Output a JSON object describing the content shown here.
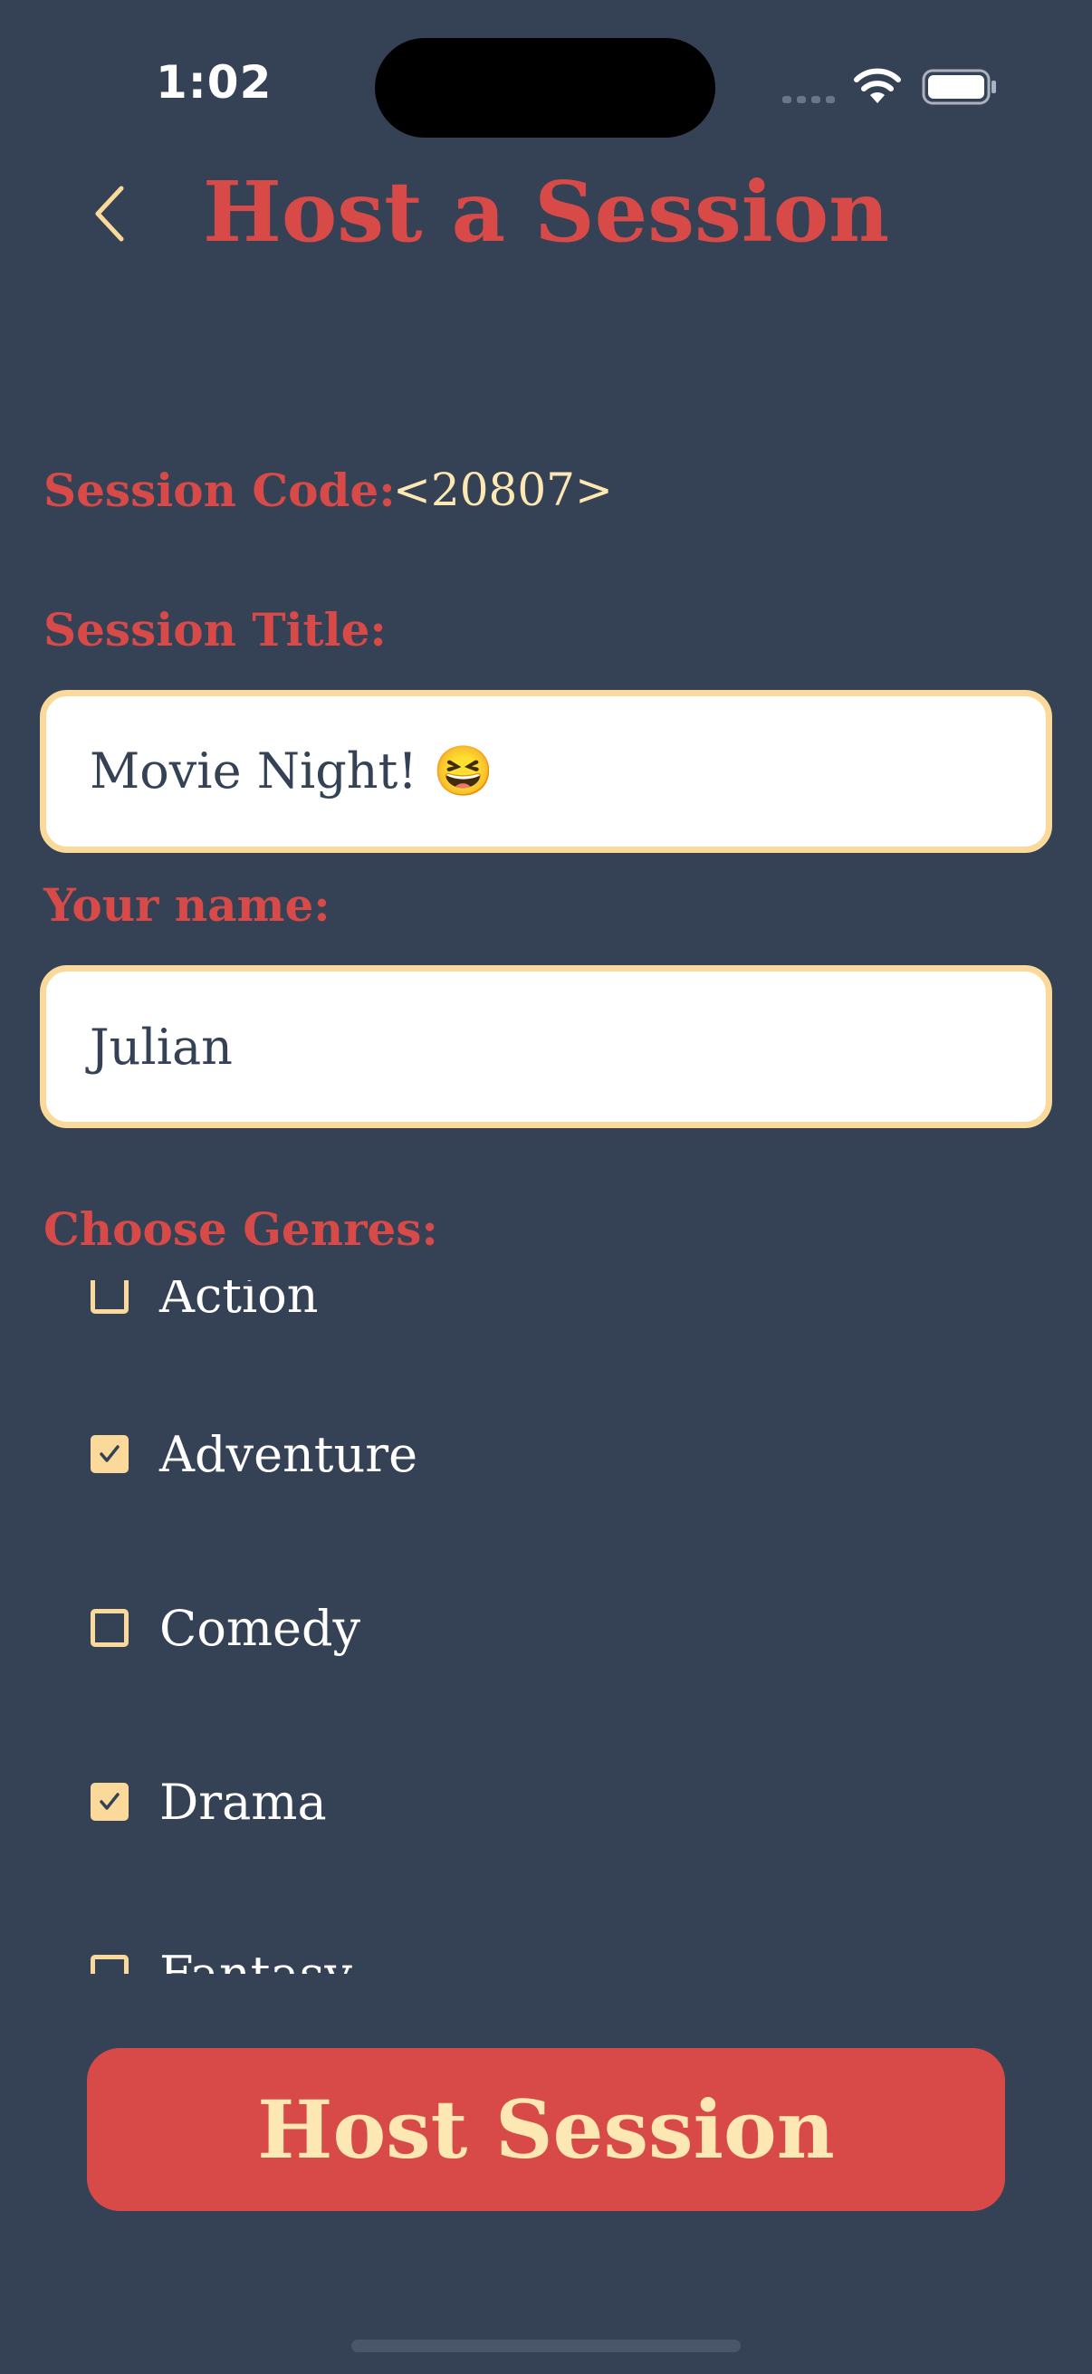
{
  "status_bar": {
    "time": "1:02"
  },
  "header": {
    "title": "Host a Session",
    "back_icon": "chevron-left-icon"
  },
  "form": {
    "session_code_label": "Session Code:",
    "session_code_value": "<20807>",
    "session_title_label": "Session Title:",
    "session_title_value": "Movie Night! 😆",
    "name_label": "Your name:",
    "name_value": "Julian",
    "genres_label": "Choose Genres:"
  },
  "genres": [
    {
      "label": "Action",
      "checked": false
    },
    {
      "label": "Adventure",
      "checked": true
    },
    {
      "label": "Comedy",
      "checked": false
    },
    {
      "label": "Drama",
      "checked": true
    },
    {
      "label": "Fantasy",
      "checked": false
    }
  ],
  "actions": {
    "host_button_label": "Host Session"
  },
  "colors": {
    "background": "#354256",
    "accent_red": "#d84a48",
    "accent_cream": "#fbd99a"
  }
}
